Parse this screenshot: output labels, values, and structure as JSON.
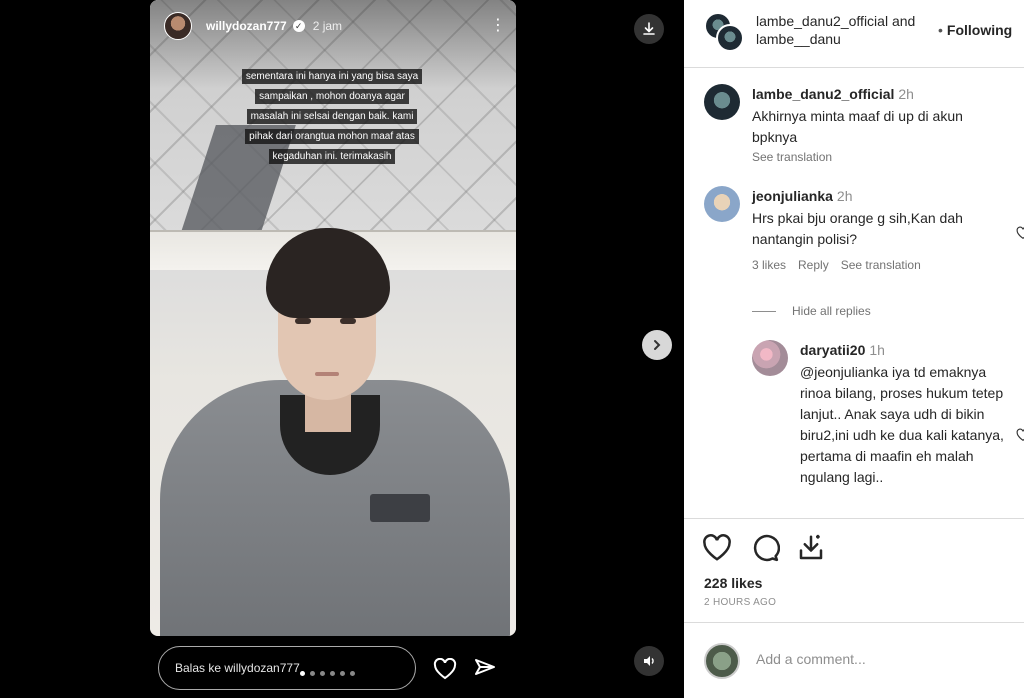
{
  "story": {
    "username": "willydozan777",
    "time": "2 jam",
    "caption": "sementara ini hanya ini yang bisa saya sampaikan , mohon doanya agar masalah ini selsai dengan baik. kami pihak dari orangtua mohon maaf atas kegaduhan ini. terimakasih",
    "reply_placeholder": "Balas ke willydozan777",
    "dots_total": 6,
    "dots_active": 0
  },
  "post": {
    "header_name": "lambe_danu2_official and lambe__danu",
    "follow_state": "Following",
    "likes": "228 likes",
    "posted_ago": "2 HOURS AGO",
    "add_comment_placeholder": "Add a comment..."
  },
  "comments": [
    {
      "username": "lambe_danu2_official",
      "time": "2h",
      "text": "Akhirnya minta maaf di up di akun bpknya",
      "see_translation": "See translation"
    },
    {
      "username": "jeonjulianka",
      "time": "2h",
      "text": "Hrs pkai bju orange g sih,Kan dah nantangin polisi?",
      "likes": "3 likes",
      "reply": "Reply",
      "see_translation": "See translation",
      "hide_replies": "Hide all replies"
    },
    {
      "username": "daryatii20",
      "time": "1h",
      "text": "@jeonjulianka iya td emaknya rinoa bilang, proses hukum tetep lanjut.. Anak saya udh di bikin biru2,ini udh ke dua kali katanya, pertama di maafin eh malah ngulang lagi.."
    }
  ],
  "icons": [
    "download-icon",
    "next-arrow-icon",
    "sound-icon",
    "heart-icon",
    "comment-icon",
    "share-icon",
    "send-icon",
    "more-icon",
    "verified-icon"
  ]
}
